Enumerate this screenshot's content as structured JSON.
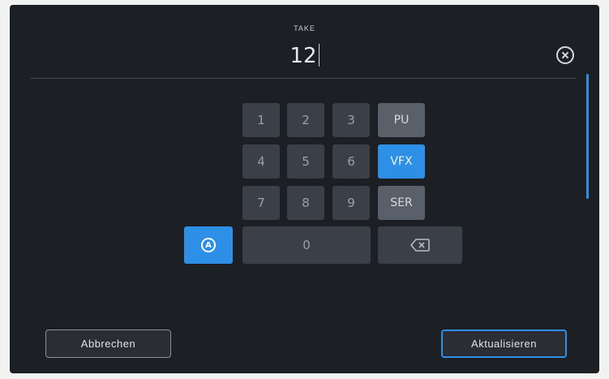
{
  "header": {
    "label": "TAKE",
    "value": "12"
  },
  "icons": {
    "clear": "clear-circle-x-icon",
    "alpha": "alpha-circle-a-icon",
    "backspace": "backspace-icon"
  },
  "keypad": {
    "digits": [
      "1",
      "2",
      "3",
      "4",
      "5",
      "6",
      "7",
      "8",
      "9",
      "0"
    ],
    "tags": [
      {
        "label": "PU",
        "active": false
      },
      {
        "label": "VFX",
        "active": true
      },
      {
        "label": "SER",
        "active": false
      }
    ],
    "alpha_letter": "A"
  },
  "buttons": {
    "cancel": "Abbrechen",
    "update": "Aktualisieren"
  },
  "colors": {
    "accent": "#2e8fe6",
    "background": "#1c1f24",
    "key": "#3b4048"
  }
}
